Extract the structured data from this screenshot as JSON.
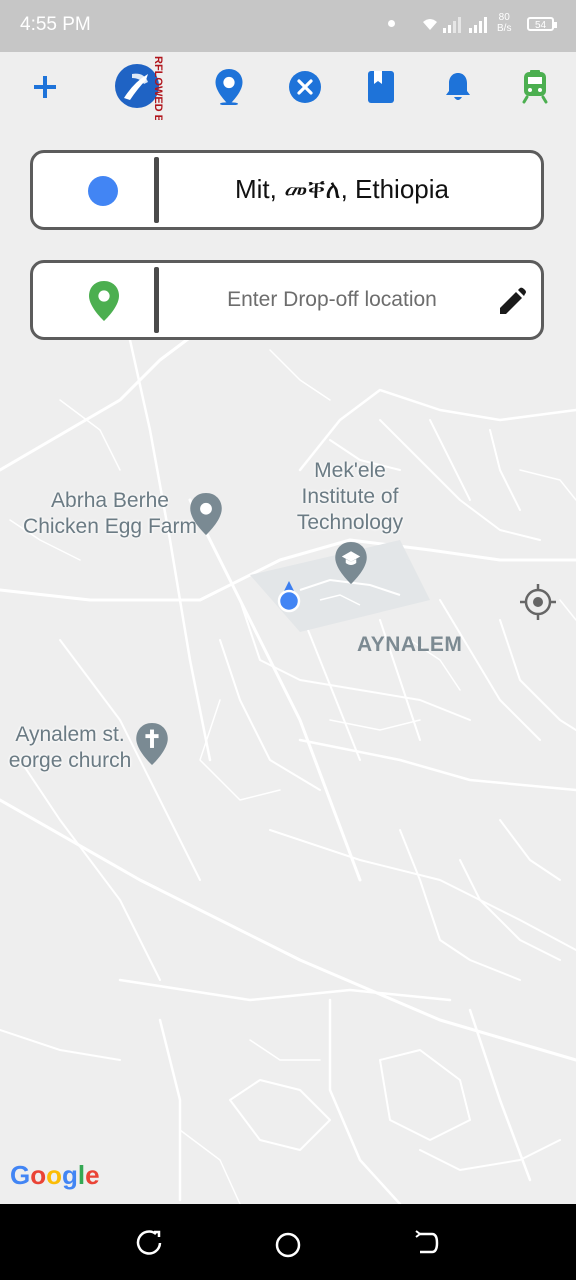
{
  "status_bar": {
    "time": "4:55 PM",
    "net_speed_value": "80",
    "net_speed_unit": "B/s",
    "battery": "54"
  },
  "toolbar": {
    "logo_text": "RFLOWED BY",
    "icons": [
      "add-icon",
      "place-marker-icon",
      "close-circle-icon",
      "bookmark-book-icon",
      "notification-bell-icon",
      "train-icon"
    ]
  },
  "origin": {
    "value": "Mit, መቐለ, Ethiopia"
  },
  "dropoff": {
    "placeholder": "Enter Drop-off location"
  },
  "map": {
    "labels": {
      "farm_line1": "Abrha Berhe",
      "farm_line2": "Chicken Egg Farm",
      "institute_line1": "Mek'ele",
      "institute_line2": "Institute of",
      "institute_line3": "Technology",
      "neighborhood": "AYNALEM",
      "church_line1": "Aynalem st.",
      "church_line2": "eorge church"
    },
    "attribution": "Google"
  },
  "colors": {
    "accent_blue": "#1e73d9",
    "green": "#4caf50",
    "map_bg": "#eeeeee",
    "label_gray": "#6b7b84"
  }
}
